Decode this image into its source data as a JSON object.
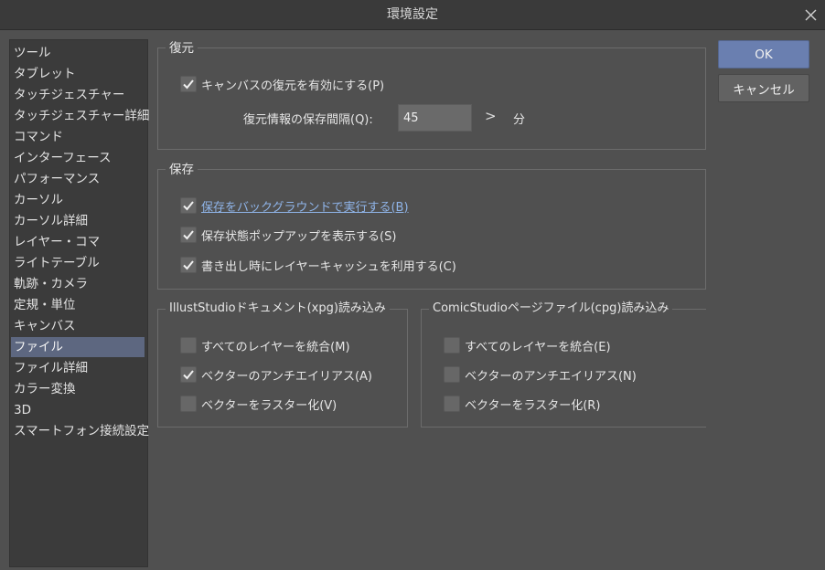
{
  "window": {
    "title": "環境設定"
  },
  "sidebar": {
    "items": [
      {
        "label": "ツール"
      },
      {
        "label": "タブレット"
      },
      {
        "label": "タッチジェスチャー"
      },
      {
        "label": "タッチジェスチャー詳細"
      },
      {
        "label": "コマンド"
      },
      {
        "label": "インターフェース"
      },
      {
        "label": "パフォーマンス"
      },
      {
        "label": "カーソル"
      },
      {
        "label": "カーソル詳細"
      },
      {
        "label": "レイヤー・コマ"
      },
      {
        "label": "ライトテーブル"
      },
      {
        "label": "軌跡・カメラ"
      },
      {
        "label": "定規・単位"
      },
      {
        "label": "キャンバス"
      },
      {
        "label": "ファイル",
        "selected": true
      },
      {
        "label": "ファイル詳細"
      },
      {
        "label": "カラー変換"
      },
      {
        "label": "3D"
      },
      {
        "label": "スマートフォン接続設定"
      }
    ]
  },
  "restore": {
    "title": "復元",
    "enable_label": "キャンバスの復元を有効にする(P)",
    "enable_checked": true,
    "interval_label": "復元情報の保存間隔(Q):",
    "interval_value": "45",
    "interval_arrow": ">",
    "interval_unit": "分"
  },
  "save": {
    "title": "保存",
    "options": [
      {
        "label": "保存をバックグラウンドで実行する(B)",
        "checked": true
      },
      {
        "label": "保存状態ポップアップを表示する(S)",
        "checked": true
      },
      {
        "label": "書き出し時にレイヤーキャッシュを利用する(C)",
        "checked": true
      }
    ]
  },
  "illust_studio": {
    "title": "IllustStudioドキュメント(xpg)読み込み",
    "options": [
      {
        "label": "すべてのレイヤーを統合(M)",
        "checked": false
      },
      {
        "label": "ベクターのアンチエイリアス(A)",
        "checked": true
      },
      {
        "label": "ベクターをラスター化(V)",
        "checked": false
      }
    ]
  },
  "comic_studio": {
    "title": "ComicStudioページファイル(cpg)読み込み",
    "options": [
      {
        "label": "すべてのレイヤーを統合(E)",
        "checked": false
      },
      {
        "label": "ベクターのアンチエイリアス(N)",
        "checked": false
      },
      {
        "label": "ベクターをラスター化(R)",
        "checked": false
      }
    ]
  },
  "buttons": {
    "ok": "OK",
    "cancel": "キャンセル"
  },
  "colors": {
    "accent": "#6a7fb0",
    "selected_row": "#5d6780",
    "link": "#8fb4e8"
  }
}
